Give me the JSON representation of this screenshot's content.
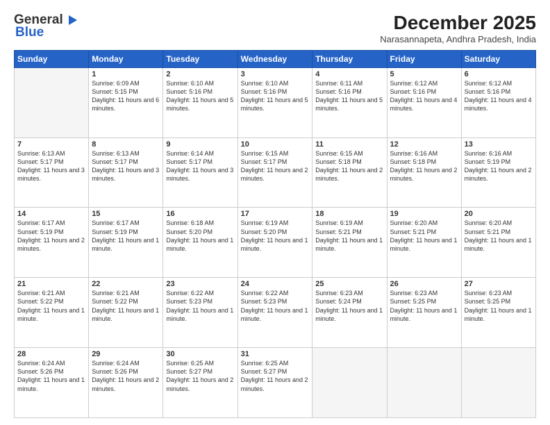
{
  "header": {
    "logo_general": "General",
    "logo_blue": "Blue",
    "month_year": "December 2025",
    "location": "Narasannapeta, Andhra Pradesh, India"
  },
  "days_of_week": [
    "Sunday",
    "Monday",
    "Tuesday",
    "Wednesday",
    "Thursday",
    "Friday",
    "Saturday"
  ],
  "weeks": [
    [
      {
        "day": "",
        "empty": true
      },
      {
        "day": "1",
        "sunrise": "6:09 AM",
        "sunset": "5:15 PM",
        "daylight": "11 hours and 6 minutes."
      },
      {
        "day": "2",
        "sunrise": "6:10 AM",
        "sunset": "5:16 PM",
        "daylight": "11 hours and 5 minutes."
      },
      {
        "day": "3",
        "sunrise": "6:10 AM",
        "sunset": "5:16 PM",
        "daylight": "11 hours and 5 minutes."
      },
      {
        "day": "4",
        "sunrise": "6:11 AM",
        "sunset": "5:16 PM",
        "daylight": "11 hours and 5 minutes."
      },
      {
        "day": "5",
        "sunrise": "6:12 AM",
        "sunset": "5:16 PM",
        "daylight": "11 hours and 4 minutes."
      },
      {
        "day": "6",
        "sunrise": "6:12 AM",
        "sunset": "5:16 PM",
        "daylight": "11 hours and 4 minutes."
      }
    ],
    [
      {
        "day": "7",
        "sunrise": "6:13 AM",
        "sunset": "5:17 PM",
        "daylight": "11 hours and 3 minutes."
      },
      {
        "day": "8",
        "sunrise": "6:13 AM",
        "sunset": "5:17 PM",
        "daylight": "11 hours and 3 minutes."
      },
      {
        "day": "9",
        "sunrise": "6:14 AM",
        "sunset": "5:17 PM",
        "daylight": "11 hours and 3 minutes."
      },
      {
        "day": "10",
        "sunrise": "6:15 AM",
        "sunset": "5:17 PM",
        "daylight": "11 hours and 2 minutes."
      },
      {
        "day": "11",
        "sunrise": "6:15 AM",
        "sunset": "5:18 PM",
        "daylight": "11 hours and 2 minutes."
      },
      {
        "day": "12",
        "sunrise": "6:16 AM",
        "sunset": "5:18 PM",
        "daylight": "11 hours and 2 minutes."
      },
      {
        "day": "13",
        "sunrise": "6:16 AM",
        "sunset": "5:19 PM",
        "daylight": "11 hours and 2 minutes."
      }
    ],
    [
      {
        "day": "14",
        "sunrise": "6:17 AM",
        "sunset": "5:19 PM",
        "daylight": "11 hours and 2 minutes."
      },
      {
        "day": "15",
        "sunrise": "6:17 AM",
        "sunset": "5:19 PM",
        "daylight": "11 hours and 1 minute."
      },
      {
        "day": "16",
        "sunrise": "6:18 AM",
        "sunset": "5:20 PM",
        "daylight": "11 hours and 1 minute."
      },
      {
        "day": "17",
        "sunrise": "6:19 AM",
        "sunset": "5:20 PM",
        "daylight": "11 hours and 1 minute."
      },
      {
        "day": "18",
        "sunrise": "6:19 AM",
        "sunset": "5:21 PM",
        "daylight": "11 hours and 1 minute."
      },
      {
        "day": "19",
        "sunrise": "6:20 AM",
        "sunset": "5:21 PM",
        "daylight": "11 hours and 1 minute."
      },
      {
        "day": "20",
        "sunrise": "6:20 AM",
        "sunset": "5:21 PM",
        "daylight": "11 hours and 1 minute."
      }
    ],
    [
      {
        "day": "21",
        "sunrise": "6:21 AM",
        "sunset": "5:22 PM",
        "daylight": "11 hours and 1 minute."
      },
      {
        "day": "22",
        "sunrise": "6:21 AM",
        "sunset": "5:22 PM",
        "daylight": "11 hours and 1 minute."
      },
      {
        "day": "23",
        "sunrise": "6:22 AM",
        "sunset": "5:23 PM",
        "daylight": "11 hours and 1 minute."
      },
      {
        "day": "24",
        "sunrise": "6:22 AM",
        "sunset": "5:23 PM",
        "daylight": "11 hours and 1 minute."
      },
      {
        "day": "25",
        "sunrise": "6:23 AM",
        "sunset": "5:24 PM",
        "daylight": "11 hours and 1 minute."
      },
      {
        "day": "26",
        "sunrise": "6:23 AM",
        "sunset": "5:25 PM",
        "daylight": "11 hours and 1 minute."
      },
      {
        "day": "27",
        "sunrise": "6:23 AM",
        "sunset": "5:25 PM",
        "daylight": "11 hours and 1 minute."
      }
    ],
    [
      {
        "day": "28",
        "sunrise": "6:24 AM",
        "sunset": "5:26 PM",
        "daylight": "11 hours and 1 minute."
      },
      {
        "day": "29",
        "sunrise": "6:24 AM",
        "sunset": "5:26 PM",
        "daylight": "11 hours and 2 minutes."
      },
      {
        "day": "30",
        "sunrise": "6:25 AM",
        "sunset": "5:27 PM",
        "daylight": "11 hours and 2 minutes."
      },
      {
        "day": "31",
        "sunrise": "6:25 AM",
        "sunset": "5:27 PM",
        "daylight": "11 hours and 2 minutes."
      },
      {
        "day": "",
        "empty": true
      },
      {
        "day": "",
        "empty": true
      },
      {
        "day": "",
        "empty": true
      }
    ]
  ]
}
